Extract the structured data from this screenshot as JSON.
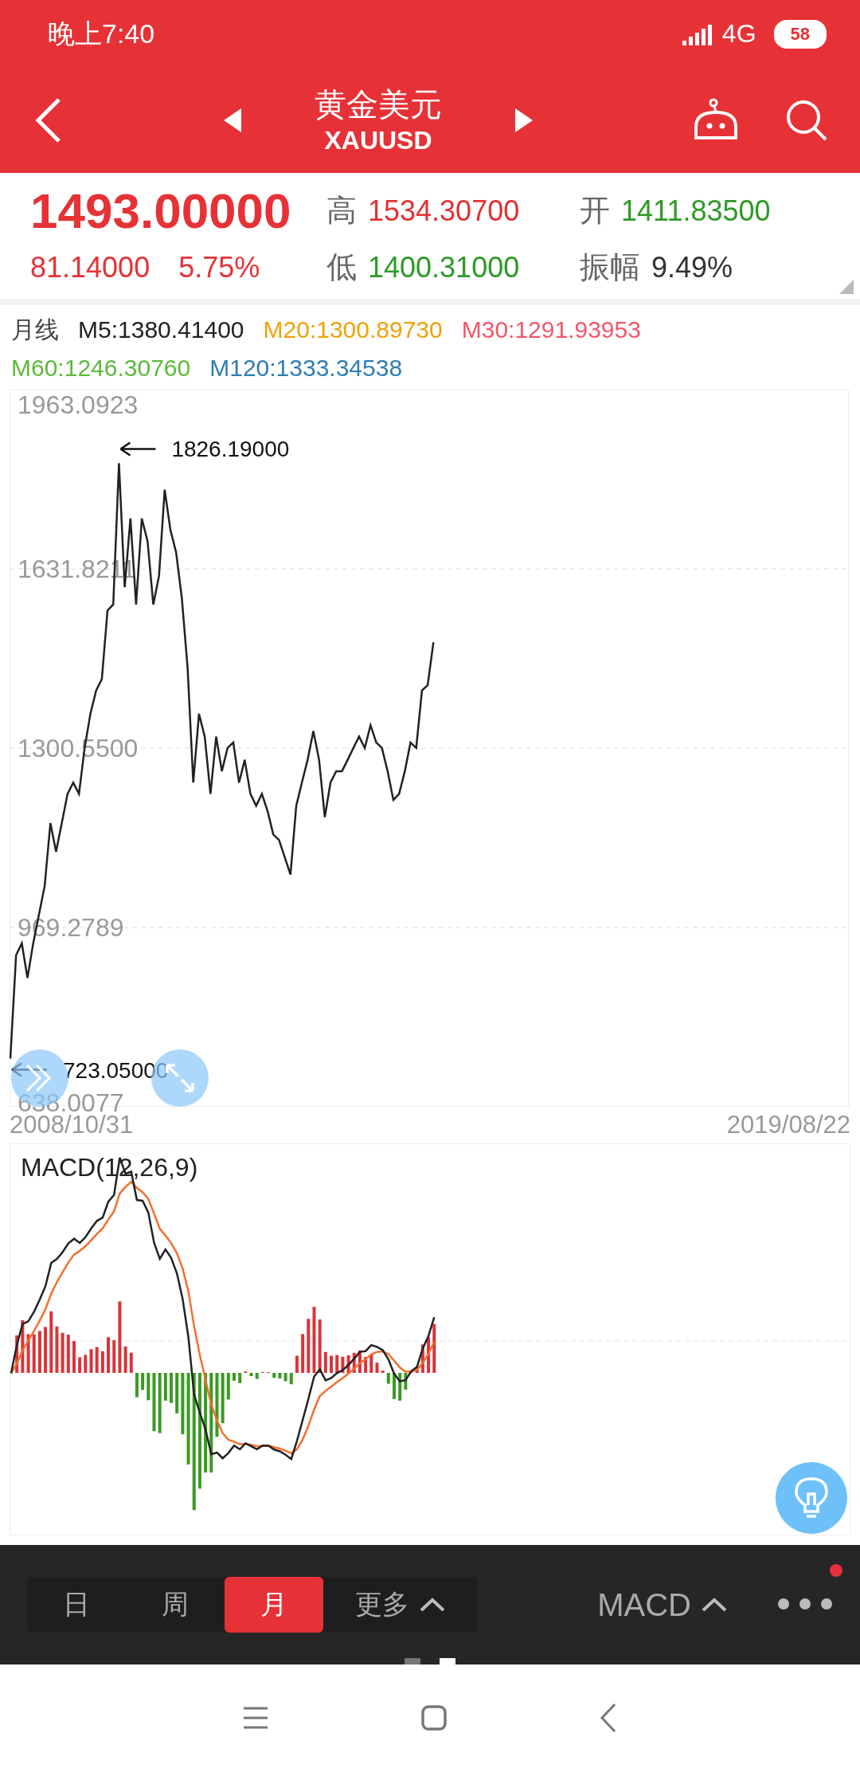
{
  "status_bar": {
    "time": "晚上7:40",
    "network": "4G",
    "battery": "58"
  },
  "header": {
    "title": "黄金美元",
    "subtitle": "XAUUSD"
  },
  "quote": {
    "price": "1493.00000",
    "change": "81.14000",
    "change_pct": "5.75%",
    "stats": [
      {
        "label": "高",
        "value": "1534.30700",
        "color": "#e03236"
      },
      {
        "label": "开",
        "value": "1411.83500",
        "color": "#2e9a27"
      },
      {
        "label": "低",
        "value": "1400.31000",
        "color": "#2e9a27"
      },
      {
        "label": "振幅",
        "value": "9.49%",
        "color": "#333333"
      }
    ]
  },
  "ma_legend": {
    "period": "月线",
    "items": [
      {
        "label": "M5:1380.41400",
        "color": "#222222"
      },
      {
        "label": "M20:1300.89730",
        "color": "#eea20c"
      },
      {
        "label": "M30:1291.93953",
        "color": "#f0576c"
      },
      {
        "label": "M60:1246.30760",
        "color": "#5cba3c"
      },
      {
        "label": "M120:1333.34538",
        "color": "#2f7db3"
      }
    ]
  },
  "price_chart": {
    "chart_data": {
      "type": "line",
      "grid": true,
      "categories": [
        null,
        null,
        null,
        null,
        null,
        null,
        null,
        null,
        null,
        null,
        null,
        null,
        null,
        null,
        null,
        null,
        null,
        null,
        null,
        null,
        null,
        null,
        null,
        null,
        null,
        null,
        null,
        null,
        null,
        null,
        null,
        null,
        null,
        null,
        null,
        null,
        null,
        null,
        null,
        null,
        null,
        null,
        null,
        null,
        null,
        null,
        null,
        null,
        null,
        null,
        null,
        null,
        null,
        null,
        null,
        null,
        null,
        null,
        null,
        null,
        null,
        null,
        null,
        null,
        null,
        null,
        null,
        null,
        null,
        null,
        null,
        null,
        null,
        null,
        null
      ],
      "ylim": [
        638.0077,
        1963.0923
      ],
      "yticks": [
        {
          "value": 1963.0923,
          "label": "1963.0923"
        },
        {
          "value": 1631.8211,
          "label": "1631.8211"
        },
        {
          "value": 1300.55,
          "label": "1300.5500"
        },
        {
          "value": 969.2789,
          "label": "969.2789"
        },
        {
          "value": 638.0077,
          "label": "638.0077"
        }
      ],
      "series": [
        {
          "color": "#222222",
          "values": [
            727,
            918,
            940,
            876,
            940,
            993,
            1046,
            1162,
            1109,
            1162,
            1216,
            1237,
            1216,
            1301,
            1364,
            1407,
            1428,
            1555,
            1566,
            1827,
            1598,
            1725,
            1566,
            1725,
            1683,
            1566,
            1619,
            1778,
            1704,
            1662,
            1577,
            1449,
            1237,
            1364,
            1322,
            1216,
            1322,
            1258,
            1301,
            1311,
            1237,
            1279,
            1216,
            1194,
            1216,
            1184,
            1141,
            1131,
            1099,
            1067,
            1194,
            1237,
            1279,
            1332,
            1279,
            1173,
            1237,
            1258,
            1258,
            1279,
            1301,
            1322,
            1301,
            1343,
            1311,
            1301,
            1258,
            1205,
            1216,
            1258,
            1311,
            1301,
            1407,
            1417,
            1496
          ]
        }
      ],
      "annotations": [
        "1826.19000",
        "723.05000"
      ]
    },
    "dates": [
      "2008/10/31",
      "2019/08/22"
    ]
  },
  "macd": {
    "title": "MACD(12,26,9)"
  },
  "bottom_bar": {
    "periods": [
      {
        "label": "日",
        "selected": false
      },
      {
        "label": "周",
        "selected": false
      },
      {
        "label": "月",
        "selected": true
      }
    ],
    "more": "更多",
    "indicator": "MACD",
    "has_notification": true,
    "pages": [
      {
        "selected": false
      },
      {
        "selected": true
      }
    ]
  }
}
